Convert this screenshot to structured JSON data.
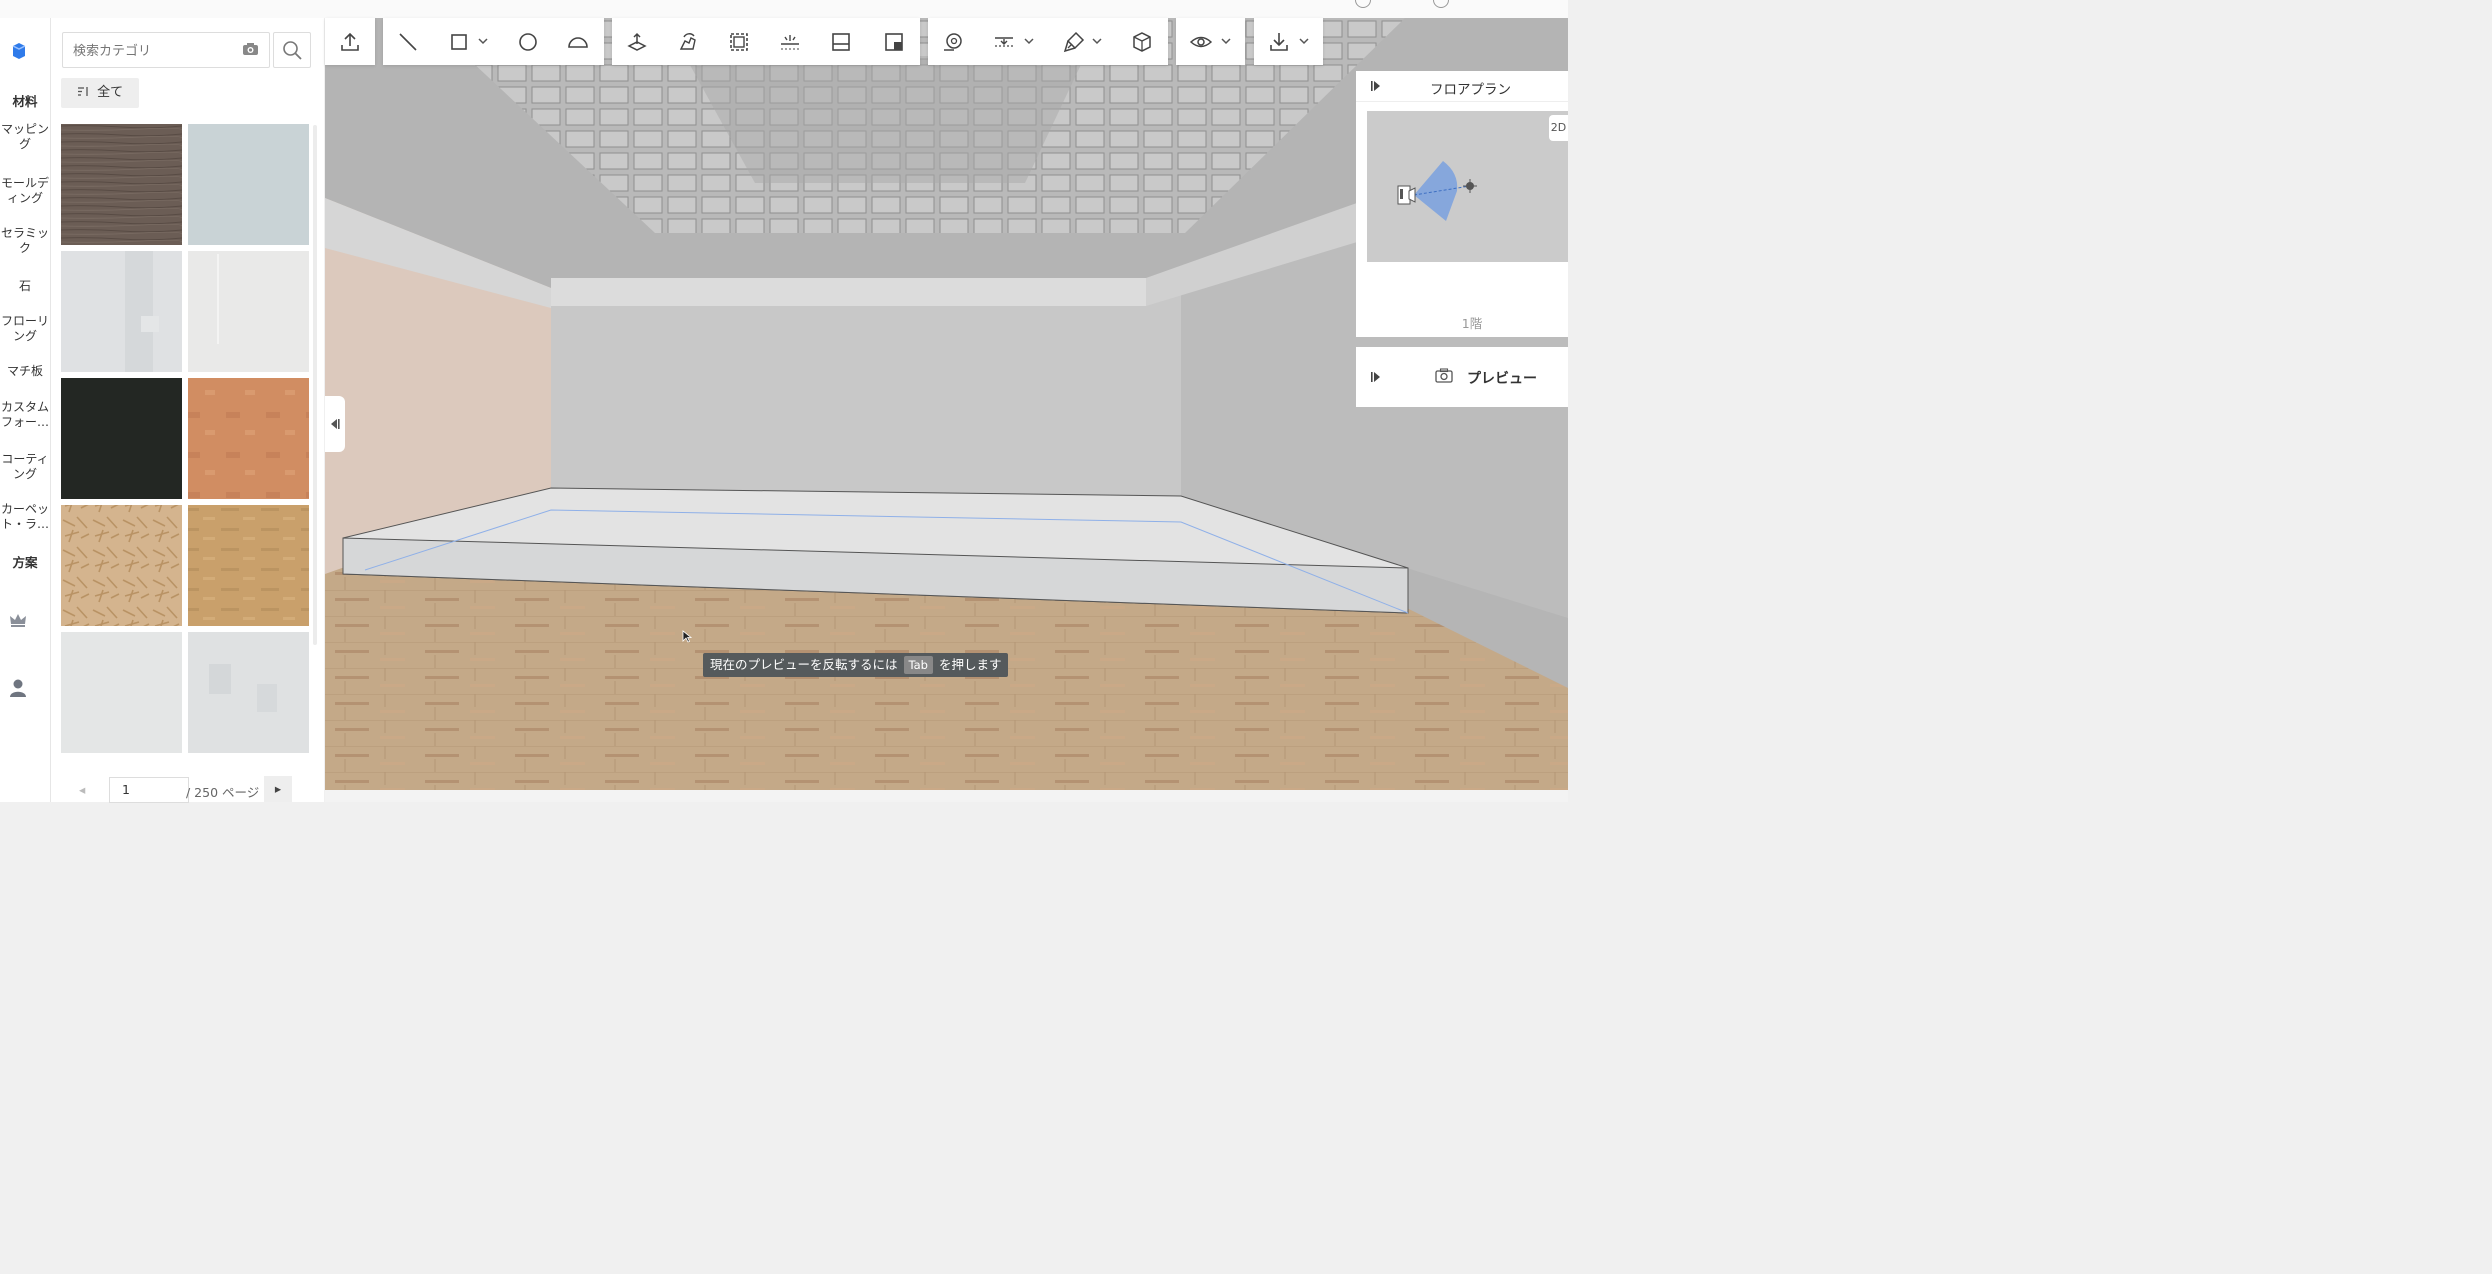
{
  "sidebar": {
    "items": [
      {
        "label": "材料",
        "bold": true
      },
      {
        "label": "マッピン",
        "label2": "グ"
      },
      {
        "label": "モールデ",
        "label2": "ィング"
      },
      {
        "label": "セラミッ",
        "label2": "ク"
      },
      {
        "label": "石"
      },
      {
        "label": "フローリ",
        "label2": "ング"
      },
      {
        "label": "マチ板"
      },
      {
        "label": "カスタム",
        "label2": "フォー…"
      },
      {
        "label": "コーティ",
        "label2": "ング"
      },
      {
        "label": "カーペッ",
        "label2": "ト・ラ…"
      },
      {
        "label": "方案",
        "bold": true
      }
    ]
  },
  "material_panel": {
    "search_placeholder": "検索カテゴリ",
    "all_button": "全て",
    "page_current": "1",
    "page_total_text": "/ 250 ページ",
    "tiles": [
      {
        "color": "#6b5d55"
      },
      {
        "color": "#c9d3d6"
      },
      {
        "color": "#dfe1e3"
      },
      {
        "color": "#e9e9e8"
      },
      {
        "color": "#232723"
      },
      {
        "color": "#d18d62"
      },
      {
        "color": "#d4b48e"
      },
      {
        "color": "#c9a06b"
      },
      {
        "color": "#e4e6e6"
      },
      {
        "color": "#dfe1e2"
      }
    ]
  },
  "toolbar": {
    "groups": [
      {
        "tools": [
          "upload-icon"
        ]
      },
      {
        "tools": [
          "line-icon",
          "rectangle-icon",
          "circle-icon",
          "arc-icon"
        ]
      },
      {
        "tools": [
          "push-pull-icon",
          "rotate-hand-icon",
          "offset-icon",
          "align-icon",
          "split-icon",
          "layout-icon"
        ]
      },
      {
        "tools": [
          "measure-icon",
          "dimension-icon",
          "paint-brush-icon",
          "box-icon"
        ]
      },
      {
        "tools": [
          "eye-icon"
        ]
      },
      {
        "tools": [
          "download-icon"
        ]
      }
    ]
  },
  "floor_plan": {
    "title": "フロアプラン",
    "view_toggle": "2D",
    "floor_label": "1階"
  },
  "preview": {
    "title": "プレビュー"
  },
  "viewport": {
    "tooltip_before": "現在のプレビューを反転するには",
    "tooltip_key": "Tab",
    "tooltip_after": "を押します"
  }
}
